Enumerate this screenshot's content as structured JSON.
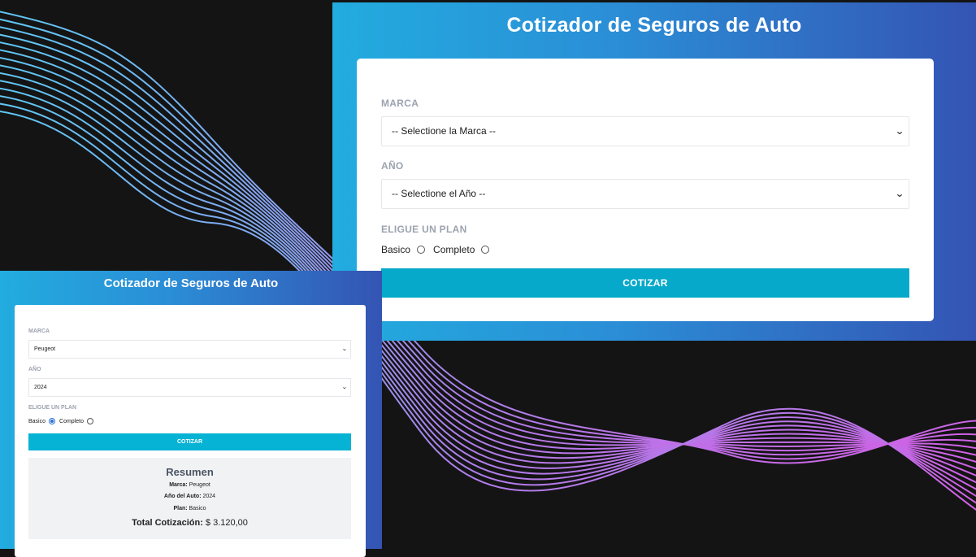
{
  "colors": {
    "background": "#141414",
    "gradient_start": "#22acdf",
    "gradient_end": "#3454b4",
    "button": "#06a9c9",
    "wave_top": "#5ec8f5",
    "wave_bottom": "#d35ee5"
  },
  "large_form": {
    "title": "Cotizador de Seguros de Auto",
    "marca_label": "MARCA",
    "marca_value": "-- Selectione la Marca --",
    "anio_label": "AÑO",
    "anio_value": "-- Selectione el Año --",
    "plan_label": "ELIGUE UN PLAN",
    "plan_basico": "Basico",
    "plan_completo": "Completo",
    "plan_selected": "none",
    "button_label": "COTIZAR"
  },
  "small_form": {
    "title": "Cotizador de Seguros de Auto",
    "marca_label": "MARCA",
    "marca_value": "Peugeot",
    "anio_label": "AÑO",
    "anio_value": "2024",
    "plan_label": "ELIGUE UN PLAN",
    "plan_basico": "Basico",
    "plan_completo": "Completo",
    "plan_selected": "Basico",
    "button_label": "COTIZAR",
    "summary": {
      "title": "Resumen",
      "marca_key": "Marca:",
      "marca_value": "Peugeot",
      "anio_key": "Año del Auto:",
      "anio_value": "2024",
      "plan_key": "Plan:",
      "plan_value": "Basico",
      "total_key": "Total Cotización:",
      "total_value": "$ 3.120,00"
    }
  }
}
